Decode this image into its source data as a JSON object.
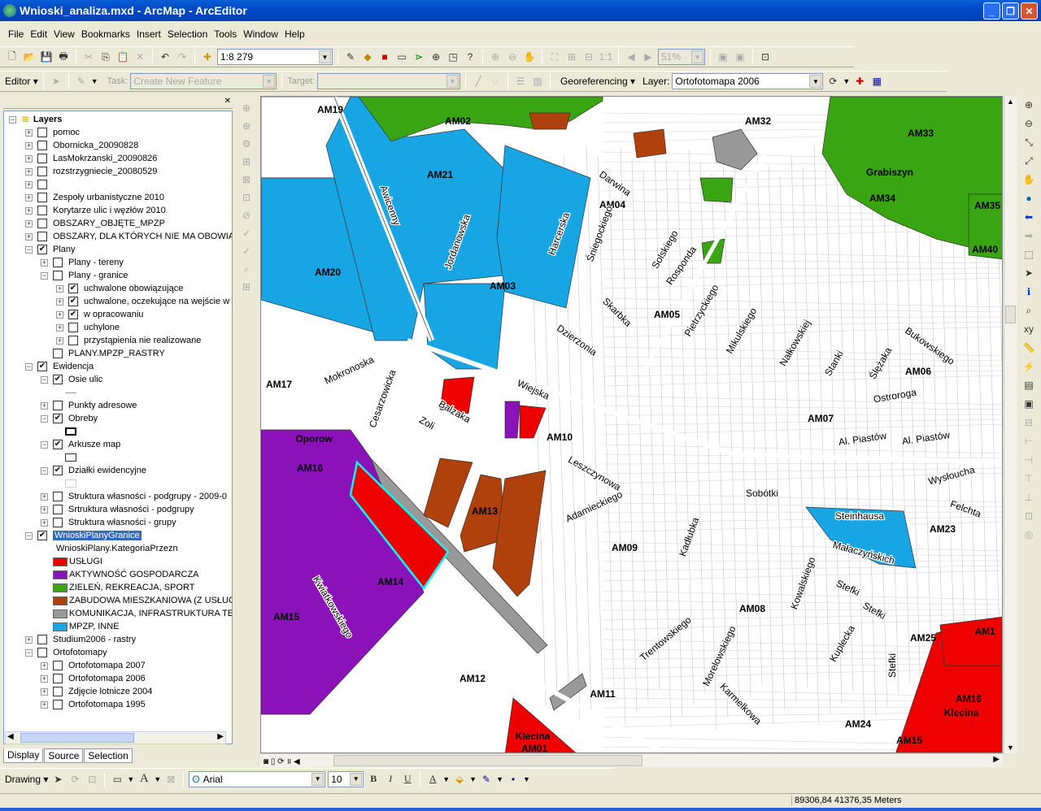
{
  "window": {
    "title": "Wnioski_analiza.mxd - ArcMap - ArcEditor"
  },
  "menu": [
    "File",
    "Edit",
    "View",
    "Bookmarks",
    "Insert",
    "Selection",
    "Tools",
    "Window",
    "Help"
  ],
  "standard_toolbar": {
    "scale": "1:8 279",
    "zoom_percent": "51%"
  },
  "editor_toolbar": {
    "editor_label": "Editor",
    "task_label": "Task:",
    "task_value": "Create New Feature",
    "target_label": "Target:",
    "target_value": ""
  },
  "georef_toolbar": {
    "georef_label": "Georeferencing",
    "layer_label": "Layer:",
    "layer_value": "Ortofotomapa 2006"
  },
  "toc": {
    "root": "Layers",
    "rows": [
      {
        "label": "pomoc",
        "level": 1,
        "exp": "+",
        "checked": false
      },
      {
        "label": "Obornicka_20090828",
        "level": 1,
        "exp": "+",
        "checked": false
      },
      {
        "label": "LasMokrzanski_20090826",
        "level": 1,
        "exp": "+",
        "checked": false
      },
      {
        "label": "rozstrzygniecie_20080529",
        "level": 1,
        "exp": "+",
        "checked": false
      },
      {
        "label": "",
        "level": 1,
        "exp": "+",
        "checked": false
      },
      {
        "label": "Zespoły urbanistyczne 2010",
        "level": 1,
        "exp": "+",
        "checked": false
      },
      {
        "label": "Korytarze ulic i węzłów 2010",
        "level": 1,
        "exp": "+",
        "checked": false
      },
      {
        "label": "OBSZARY_OBJĘTE_MPZP",
        "level": 1,
        "exp": "+",
        "checked": false
      },
      {
        "label": "OBSZARY, DLA KTÓRYCH NIE MA OBOWIĄZ",
        "level": 1,
        "exp": "+",
        "checked": false
      },
      {
        "label": "Plany",
        "level": 1,
        "exp": "-",
        "checked": true
      },
      {
        "label": "Plany - tereny",
        "level": 2,
        "exp": "+",
        "checked": false
      },
      {
        "label": "Plany - granice",
        "level": 2,
        "exp": "-",
        "checked": false
      },
      {
        "label": "uchwalone obowiązujące",
        "level": 3,
        "exp": "+",
        "checked": true
      },
      {
        "label": "uchwalone, oczekujące na wejście w",
        "level": 3,
        "exp": "+",
        "checked": true
      },
      {
        "label": "w opracowaniu",
        "level": 3,
        "exp": "+",
        "checked": true
      },
      {
        "label": "uchylone",
        "level": 3,
        "exp": "+",
        "checked": false
      },
      {
        "label": "przystąpienia nie realizowane",
        "level": 3,
        "exp": "+",
        "checked": false
      },
      {
        "label": "PLANY.MPZP_RASTRY",
        "level": 2,
        "exp": "",
        "checked": false
      },
      {
        "label": "Ewidencja",
        "level": 1,
        "exp": "-",
        "checked": true
      },
      {
        "label": "Osie ulic",
        "level": 2,
        "exp": "-",
        "checked": true
      },
      {
        "label": "",
        "level": 2,
        "symbol": "line"
      },
      {
        "label": "Punkty adresowe",
        "level": 2,
        "exp": "+",
        "checked": false
      },
      {
        "label": "Obreby",
        "level": 2,
        "exp": "-",
        "checked": true
      },
      {
        "label": "",
        "level": 2,
        "symbol": "box-thick"
      },
      {
        "label": "Arkusze map",
        "level": 2,
        "exp": "-",
        "checked": true
      },
      {
        "label": "",
        "level": 2,
        "symbol": "box"
      },
      {
        "label": "Działki ewidencyjne",
        "level": 2,
        "exp": "-",
        "checked": true
      },
      {
        "label": "",
        "level": 2,
        "symbol": "box-light"
      },
      {
        "label": "Struktura własności - podgrupy - 2009-0",
        "level": 2,
        "exp": "+",
        "checked": false
      },
      {
        "label": "Srtruktura własności - podgrupy",
        "level": 2,
        "exp": "+",
        "checked": false
      },
      {
        "label": "Struktura własności - grupy",
        "level": 2,
        "exp": "+",
        "checked": false
      },
      {
        "label": "WnioskiPlanyGranice",
        "level": 1,
        "exp": "-",
        "checked": true,
        "selected": true
      },
      {
        "label": "WnioskiPlany.KategoriaPrzezn",
        "level": 2,
        "exp": ""
      },
      {
        "label": "USŁUGI",
        "level": 1,
        "swatch": "#ee0000"
      },
      {
        "label": "AKTYWNOŚĆ GOSPODARCZA",
        "level": 1,
        "swatch": "#8a12b8"
      },
      {
        "label": "ZIELEŃ, REKREACJA, SPORT",
        "level": 1,
        "swatch": "#3aa512"
      },
      {
        "label": "ZABUDOWA MIESZKANIOWA (Z USŁUGA",
        "level": 1,
        "swatch": "#b0400c"
      },
      {
        "label": "KOMUNIKACJA, INFRASTRUKTURA TECH",
        "level": 1,
        "swatch": "#999999"
      },
      {
        "label": "MPZP, INNE",
        "level": 1,
        "swatch": "#17a6e3"
      },
      {
        "label": "Studium2006 - rastry",
        "level": 1,
        "exp": "+",
        "checked": false
      },
      {
        "label": "Ortofotomapy",
        "level": 1,
        "exp": "-",
        "checked": false
      },
      {
        "label": "Ortofotomapa 2007",
        "level": 2,
        "exp": "+",
        "checked": false
      },
      {
        "label": "Ortofotomapa 2006",
        "level": 2,
        "exp": "+",
        "checked": false
      },
      {
        "label": "Zdjęcie lotnicze 2004",
        "level": 2,
        "exp": "+",
        "checked": false
      },
      {
        "label": "Ortofotomapa 1995",
        "level": 2,
        "exp": "+",
        "checked": false
      }
    ],
    "tabs": [
      "Display",
      "Source",
      "Selection"
    ]
  },
  "colors": {
    "uslugi": "#ee0000",
    "aktywnosc": "#8a12b8",
    "zielen": "#3aa512",
    "zabudowa": "#b0400c",
    "komunikacja": "#999999",
    "mpzp": "#17a6e3",
    "selection": "#00ffff"
  },
  "map": {
    "area_labels": [
      "AM19",
      "AM02",
      "AM21",
      "AM20",
      "AM03",
      "AM32",
      "AM33",
      "Grabiszyn",
      "AM34",
      "AM35",
      "AM40",
      "AM04",
      "AM05",
      "AM06",
      "AM07",
      "AM17",
      "Oporow",
      "AM16",
      "AM10",
      "AM13",
      "AM14",
      "AM15",
      "AM09",
      "AM08",
      "AM23",
      "AM25",
      "AM1",
      "AM12",
      "AM11",
      "Klecina",
      "AM01",
      "AM24",
      "AM16",
      "Klecina",
      "AM15"
    ],
    "street_labels": [
      "Awicenny",
      "Jordanowska",
      "Harcerska",
      "Darwina",
      "Śniegockiego",
      "Solskiego",
      "Rosponda",
      "Skarbka",
      "Dzierżonia",
      "Pietrzyckiego",
      "Mikulskiego",
      "Nałkowskiej",
      "Stanki",
      "Ślężaka",
      "Bukowskiego",
      "Ostroroga",
      "Al. Piastów",
      "Al. Piastów",
      "Wysłoucha",
      "Felchta",
      "Steinhausa",
      "Małaczyńskich",
      "Kowalskiego",
      "Stefki",
      "Stefki",
      "Kuplecka",
      "Stefki",
      "Sobótki",
      "Mokronoska",
      "Cesarzowicka",
      "Balzaka",
      "Zoli",
      "Wiejska",
      "Leszczynowa",
      "Adamieckiego",
      "Kadłubka",
      "Trentowskiego",
      "Morelowskiego",
      "Karmelkowa",
      "Kwiatkowskiego"
    ]
  },
  "drawing_toolbar": {
    "drawing_label": "Drawing",
    "font": "Arial",
    "size": "10",
    "bold": "B",
    "italic": "I",
    "underline": "U",
    "text_icon": "A"
  },
  "status": {
    "coordinates": "89306,84  41376,35 Meters"
  }
}
